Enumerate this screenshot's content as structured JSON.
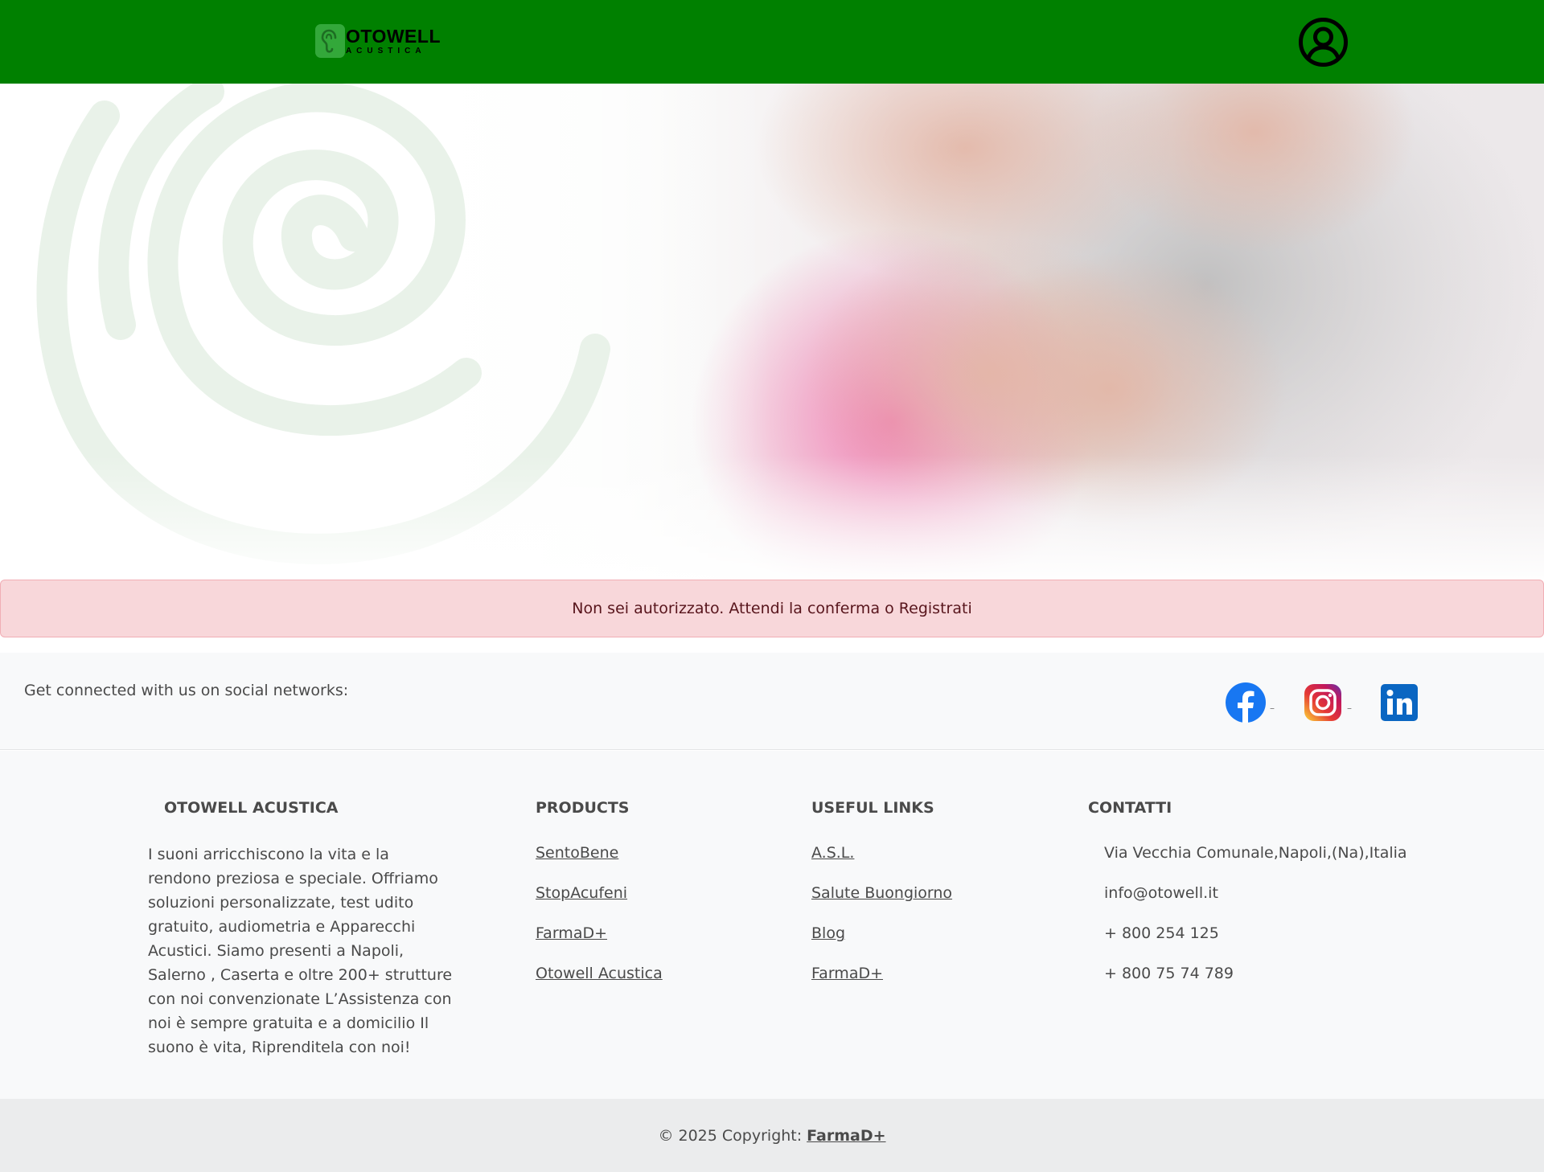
{
  "header": {
    "logo": {
      "main": "OTOWELL",
      "sub": "ACUSTICA"
    },
    "user_icon": "user-circle-icon"
  },
  "alert": {
    "message": "Non sei autorizzato. Attendi la conferma o Registrati"
  },
  "social": {
    "text": "Get connected with us on social networks:",
    "links": [
      {
        "icon": "facebook-icon",
        "color": "#1877f2"
      },
      {
        "icon": "instagram-icon",
        "color": "#d6249f"
      },
      {
        "icon": "linkedin-icon",
        "color": "#0a66c2"
      }
    ]
  },
  "footer": {
    "about": {
      "title": "OTOWELL ACUSTICA",
      "text": "I suoni arricchiscono la vita e la rendono preziosa e speciale. Offriamo soluzioni personalizzate, test udito gratuito, audiometria e Apparecchi Acustici. Siamo presenti a Napoli, Salerno , Caserta e oltre 200+ strutture con noi convenzionate L’Assistenza con noi è sempre gratuita e a domicilio Il suono è vita, Riprenditela con noi!"
    },
    "products": {
      "title": "PRODUCTS",
      "links": [
        "SentoBene",
        "StopAcufeni",
        "FarmaD+",
        "Otowell Acustica"
      ]
    },
    "useful_links": {
      "title": "USEFUL LINKS",
      "links": [
        "A.S.L.",
        "Salute Buongiorno",
        "Blog",
        "FarmaD+"
      ]
    },
    "contacts": {
      "title": "CONTATTI",
      "items": [
        "Via Vecchia Comunale,Napoli,(Na),Italia",
        "info@otowell.it",
        "+ 800 254 125",
        "+ 800 75 74 789"
      ]
    }
  },
  "copyright": {
    "text": "© 2025 Copyright:",
    "link": "FarmaD+"
  },
  "colors": {
    "navbar": "#008000",
    "alert_bg": "#f8d7da",
    "alert_text": "#58151c",
    "footer_bg": "#f8f9fa",
    "copyright_bg": "#ebeced"
  }
}
